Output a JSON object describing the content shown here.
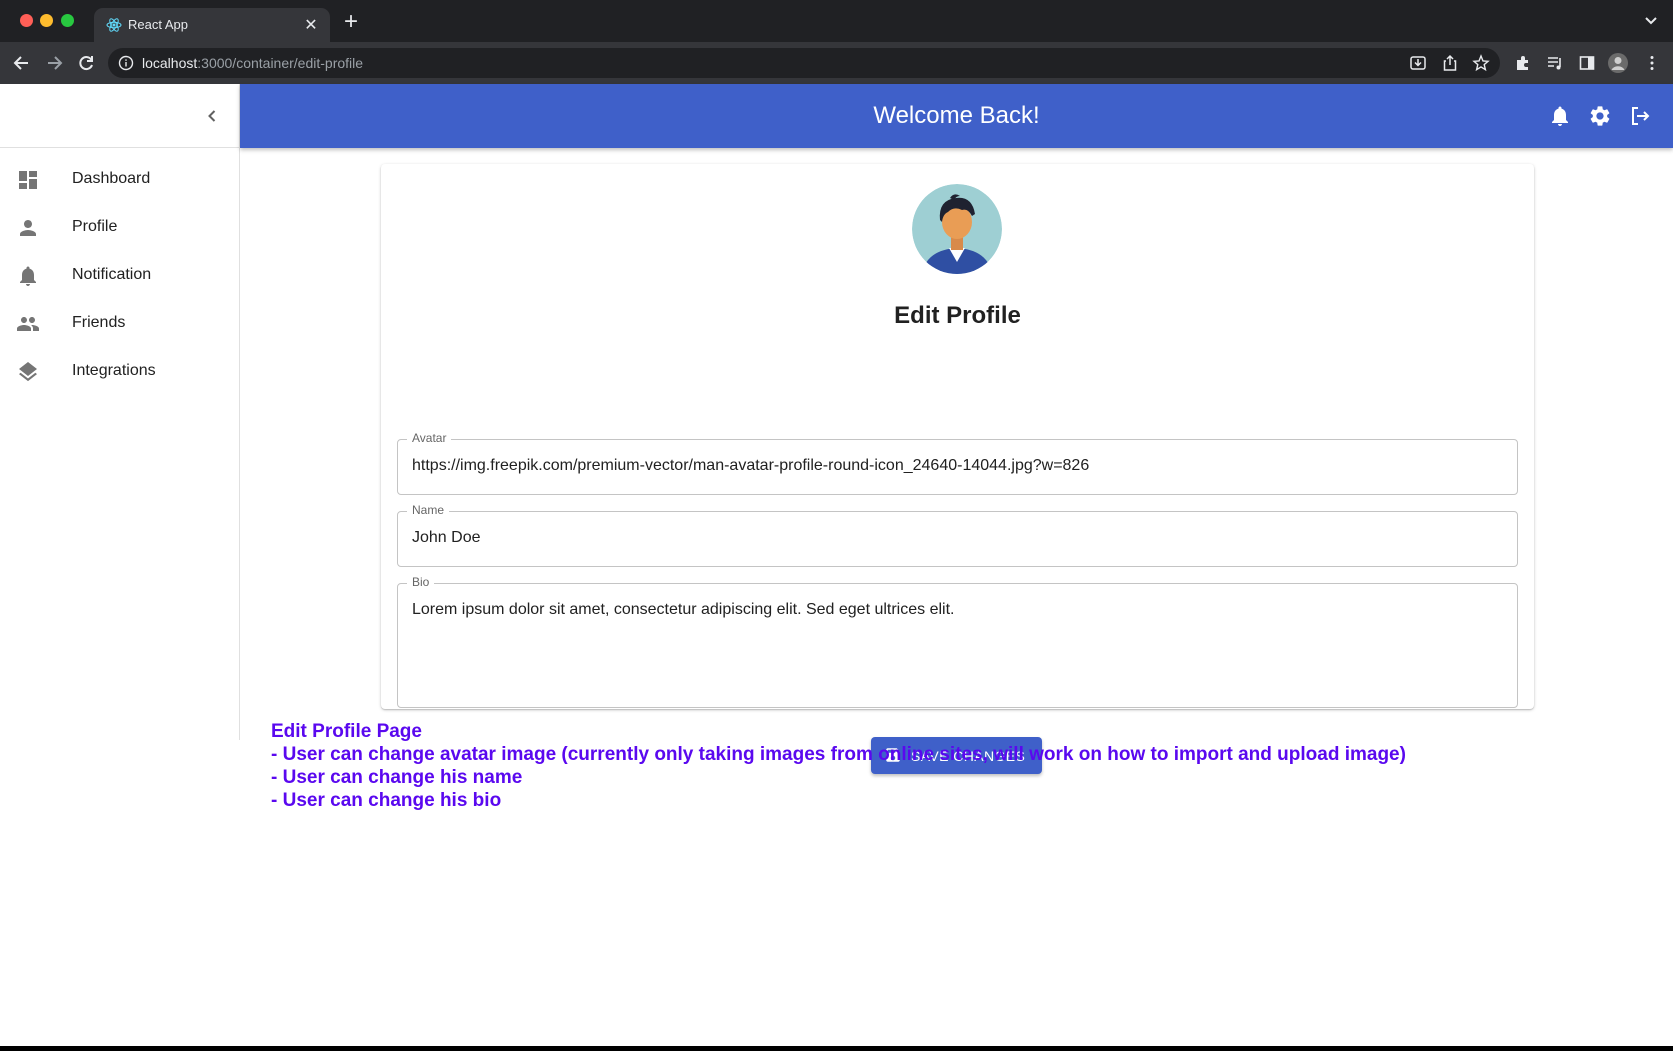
{
  "browser": {
    "tab_title": "React App",
    "url_host": "localhost",
    "url_path": ":3000/container/edit-profile"
  },
  "sidebar": {
    "items": [
      {
        "label": "Dashboard",
        "icon": "dashboard-icon"
      },
      {
        "label": "Profile",
        "icon": "person-icon"
      },
      {
        "label": "Notification",
        "icon": "bell-icon"
      },
      {
        "label": "Friends",
        "icon": "people-icon"
      },
      {
        "label": "Integrations",
        "icon": "layers-icon"
      }
    ]
  },
  "header": {
    "title": "Welcome Back!"
  },
  "form": {
    "title": "Edit Profile",
    "avatar_label": "Avatar",
    "avatar_value": "https://img.freepik.com/premium-vector/man-avatar-profile-round-icon_24640-14044.jpg?w=826",
    "name_label": "Name",
    "name_value": "John Doe",
    "bio_label": "Bio",
    "bio_value": "Lorem ipsum dolor sit amet, consectetur adipiscing elit. Sed eget ultrices elit.",
    "save_label": "SAVE CHANGES"
  },
  "notes": [
    "Edit Profile Page",
    "- User can change avatar image (currently only taking images from online sites, will work on how to import and upload image)",
    "- User can change his name",
    "- User can change his bio"
  ],
  "colors": {
    "primary": "#3f60c9",
    "note_text": "#5a08ef"
  }
}
